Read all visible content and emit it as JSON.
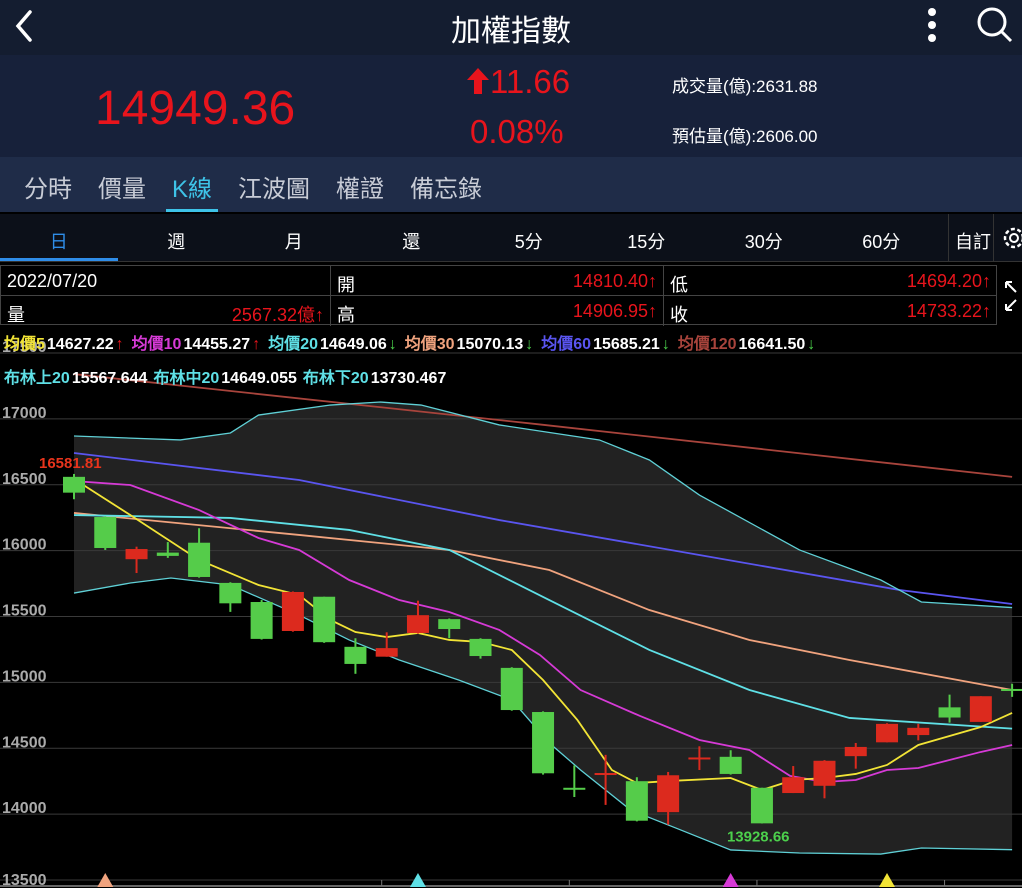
{
  "header": {
    "title": "加權指數"
  },
  "quote": {
    "price": "14949.36",
    "change": "11.66",
    "change_pct": "0.08%",
    "volume_label": "成交量(億):2631.88",
    "est_volume_label": "預估量(億):2606.00"
  },
  "tabs": [
    {
      "label": "分時"
    },
    {
      "label": "價量"
    },
    {
      "label": "K線"
    },
    {
      "label": "江波圖"
    },
    {
      "label": "權證"
    },
    {
      "label": "備忘錄"
    }
  ],
  "periods": [
    {
      "label": "日"
    },
    {
      "label": "週"
    },
    {
      "label": "月"
    },
    {
      "label": "還"
    },
    {
      "label": "5分"
    },
    {
      "label": "15分"
    },
    {
      "label": "30分"
    },
    {
      "label": "60分"
    }
  ],
  "custom_label": "自訂",
  "info": {
    "date": "2022/07/20",
    "open_label": "開",
    "open": "14810.40↑",
    "low_label": "低",
    "low": "14694.20↑",
    "volume_label": "量",
    "volume": "2567.32億↑",
    "high_label": "高",
    "high": "14906.95↑",
    "close_label": "收",
    "close": "14733.22↑"
  },
  "ma_legend": [
    {
      "label": "均價5",
      "value": "14627.22",
      "arrow": "↑",
      "color": "#f2e436",
      "arrow_color": "#e8141c"
    },
    {
      "label": "均價10",
      "value": "14455.27",
      "arrow": "↑",
      "color": "#d63ad6",
      "arrow_color": "#e8141c"
    },
    {
      "label": "均價20",
      "value": "14649.06",
      "arrow": "↓",
      "color": "#5fe0e6",
      "arrow_color": "#4cd04c"
    },
    {
      "label": "均價30",
      "value": "15070.13",
      "arrow": "↓",
      "color": "#f0a37e",
      "arrow_color": "#4cd04c"
    },
    {
      "label": "均價60",
      "value": "15685.21",
      "arrow": "↓",
      "color": "#5a55f0",
      "arrow_color": "#4cd04c"
    },
    {
      "label": "均價120",
      "value": "16641.50",
      "arrow": "↓",
      "color": "#a8443c",
      "arrow_color": "#4cd04c"
    }
  ],
  "bb_legend": [
    {
      "label": "布林上20",
      "value": "15567.644"
    },
    {
      "label": "布林中20",
      "value": "14649.055"
    },
    {
      "label": "布林下20",
      "value": "13730.467"
    }
  ],
  "chart_data": {
    "type": "candlestick",
    "ylim": [
      13500,
      17500
    ],
    "yticks": [
      "17500",
      "17000",
      "16500",
      "16000",
      "15500",
      "15000",
      "14500",
      "14000",
      "13500"
    ],
    "annotations": [
      {
        "index": 0,
        "text": "16581.81",
        "color": "#e8341c"
      },
      {
        "index": 22,
        "text": "13928.66",
        "color": "#4cd04c"
      }
    ],
    "markers": [
      {
        "index": 1,
        "color": "#f0a37e"
      },
      {
        "index": 11,
        "color": "#5fe0e6"
      },
      {
        "index": 21,
        "color": "#d63ad6"
      },
      {
        "index": 26,
        "color": "#f2e436"
      }
    ],
    "candles": [
      [
        16560,
        16582,
        16390,
        16440
      ],
      [
        16255,
        16260,
        16005,
        16020
      ],
      [
        15935,
        16030,
        15830,
        16012
      ],
      [
        15985,
        16065,
        15945,
        15960
      ],
      [
        16060,
        16170,
        15795,
        15800
      ],
      [
        15755,
        15760,
        15535,
        15600
      ],
      [
        15610,
        15625,
        15325,
        15330
      ],
      [
        15390,
        15690,
        15385,
        15686
      ],
      [
        15650,
        15650,
        15300,
        15305
      ],
      [
        15270,
        15335,
        15065,
        15140
      ],
      [
        15195,
        15380,
        15195,
        15260
      ],
      [
        15375,
        15620,
        15370,
        15510
      ],
      [
        15480,
        15485,
        15335,
        15405
      ],
      [
        15330,
        15335,
        15180,
        15200
      ],
      [
        15110,
        15115,
        14785,
        14790
      ],
      [
        14775,
        14780,
        14300,
        14310
      ],
      [
        14200,
        14370,
        14130,
        14190
      ],
      [
        14305,
        14450,
        14070,
        14312
      ],
      [
        14250,
        14280,
        13945,
        13950
      ],
      [
        14015,
        14320,
        13920,
        14295
      ],
      [
        14420,
        14515,
        14335,
        14430
      ],
      [
        14435,
        14485,
        14300,
        14305
      ],
      [
        14200,
        14200,
        13929,
        13930
      ],
      [
        14160,
        14365,
        14160,
        14280
      ],
      [
        14215,
        14410,
        14120,
        14405
      ],
      [
        14440,
        14540,
        14345,
        14510
      ],
      [
        14545,
        14690,
        14545,
        14685
      ],
      [
        14600,
        14685,
        14560,
        14655
      ],
      [
        14810.4,
        14906.95,
        14694.2,
        14733.22
      ],
      [
        14700,
        14895,
        14700,
        14895
      ],
      [
        14950,
        14990,
        14890,
        14940
      ]
    ],
    "series": [
      {
        "name": "MA120",
        "color": "#a8443c",
        "points": [
          [
            0,
            17340
          ],
          [
            15,
            16955
          ],
          [
            30,
            16560
          ]
        ]
      },
      {
        "name": "MA60",
        "color": "#5a55f0",
        "points": [
          [
            0,
            16741
          ],
          [
            7.2,
            16536
          ],
          [
            13.6,
            16232
          ],
          [
            20,
            15967
          ],
          [
            26.4,
            15701
          ],
          [
            30,
            15595
          ]
        ]
      },
      {
        "name": "MA30",
        "color": "#f0a37e",
        "points": [
          [
            0,
            16286
          ],
          [
            7.2,
            16119
          ],
          [
            12,
            16005
          ],
          [
            15.2,
            15853
          ],
          [
            18.4,
            15549
          ],
          [
            21.6,
            15322
          ],
          [
            24.8,
            15170
          ],
          [
            30,
            14942
          ]
        ]
      },
      {
        "name": "BB-upper",
        "color": "#5fd0d6",
        "points": [
          [
            0,
            16870
          ],
          [
            3.4,
            16840
          ],
          [
            5,
            16893
          ],
          [
            5.9,
            17029
          ],
          [
            8.2,
            17105
          ],
          [
            9.8,
            17128
          ],
          [
            11.1,
            17105
          ],
          [
            13.6,
            16954
          ],
          [
            16.8,
            16840
          ],
          [
            18.4,
            16688
          ],
          [
            20,
            16422
          ],
          [
            23.2,
            16005
          ],
          [
            25.8,
            15777
          ],
          [
            27.1,
            15610
          ],
          [
            30,
            15568
          ]
        ]
      },
      {
        "name": "BB-lower",
        "color": "#5fd0d6",
        "points": [
          [
            0,
            15678
          ],
          [
            1.8,
            15754
          ],
          [
            3.1,
            15792
          ],
          [
            5,
            15739
          ],
          [
            7.2,
            15511
          ],
          [
            8.8,
            15322
          ],
          [
            10.4,
            15170
          ],
          [
            12.3,
            15018
          ],
          [
            14,
            14866
          ],
          [
            15.2,
            14540
          ],
          [
            16.2,
            14335
          ],
          [
            17.8,
            14031
          ],
          [
            19.4,
            13880
          ],
          [
            21,
            13728
          ],
          [
            23.2,
            13705
          ],
          [
            25.8,
            13697
          ],
          [
            27.1,
            13743
          ],
          [
            30,
            13730
          ]
        ]
      },
      {
        "name": "MA20",
        "color": "#5fe0e6",
        "points": [
          [
            0,
            16270
          ],
          [
            5,
            16248
          ],
          [
            8.8,
            16157
          ],
          [
            12,
            16005
          ],
          [
            15.2,
            15625
          ],
          [
            18.4,
            15246
          ],
          [
            21.6,
            14942
          ],
          [
            24.8,
            14730
          ],
          [
            30,
            14649
          ]
        ]
      },
      {
        "name": "MA10",
        "color": "#d63ad6",
        "points": [
          [
            0,
            16528
          ],
          [
            1.8,
            16498
          ],
          [
            4,
            16308
          ],
          [
            5.9,
            16096
          ],
          [
            7.2,
            16005
          ],
          [
            8.8,
            15777
          ],
          [
            10.4,
            15625
          ],
          [
            12,
            15534
          ],
          [
            13.6,
            15398
          ],
          [
            14.9,
            15208
          ],
          [
            16.2,
            14942
          ],
          [
            18.1,
            14745
          ],
          [
            20,
            14563
          ],
          [
            21.6,
            14487
          ],
          [
            22.9,
            14290
          ],
          [
            24,
            14244
          ],
          [
            25,
            14259
          ],
          [
            26,
            14335
          ],
          [
            27,
            14350
          ],
          [
            29,
            14472
          ],
          [
            30,
            14525
          ]
        ]
      },
      {
        "name": "MA5",
        "color": "#f2e436",
        "points": [
          [
            0,
            16544
          ],
          [
            1.8,
            16270
          ],
          [
            4,
            15929
          ],
          [
            5.9,
            15739
          ],
          [
            7.2,
            15663
          ],
          [
            8.2,
            15474
          ],
          [
            9,
            15382
          ],
          [
            10,
            15344
          ],
          [
            11,
            15375
          ],
          [
            12,
            15322
          ],
          [
            13,
            15307
          ],
          [
            14,
            15246
          ],
          [
            15,
            15018
          ],
          [
            16.1,
            14714
          ],
          [
            17.2,
            14335
          ],
          [
            18,
            14236
          ],
          [
            19,
            14251
          ],
          [
            21,
            14274
          ],
          [
            22,
            14183
          ],
          [
            23,
            14259
          ],
          [
            24,
            14274
          ],
          [
            25,
            14305
          ],
          [
            26,
            14373
          ],
          [
            27,
            14525
          ],
          [
            29,
            14661
          ],
          [
            30,
            14768
          ]
        ]
      }
    ]
  }
}
